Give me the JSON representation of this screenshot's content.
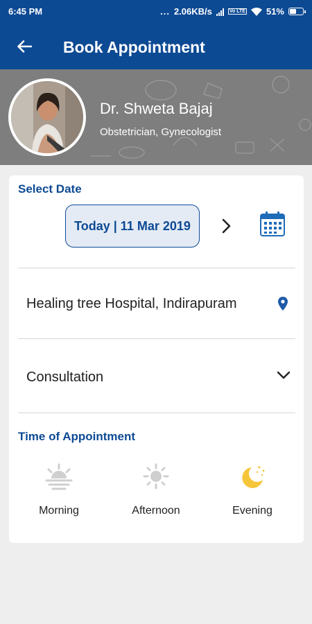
{
  "status_bar": {
    "time": "6:45 PM",
    "dots": "...",
    "network_speed": "2.06KB/s",
    "volte": "Vo LTE",
    "battery": "51%",
    "battery_level": 0.51
  },
  "header": {
    "title": "Book Appointment",
    "back_icon": "arrow-left-icon"
  },
  "doctor": {
    "name": "Dr. Shweta Bajaj",
    "specialization": "Obstetrician, Gynecologist"
  },
  "appointment": {
    "select_date_label": "Select Date",
    "date": "Today | 11 Mar 2019",
    "hospital": "Healing tree Hospital, Indirapuram",
    "type": "Consultation",
    "time_label": "Time of Appointment",
    "slots": [
      {
        "label": "Morning",
        "icon": "sunrise-icon"
      },
      {
        "label": "Afternoon",
        "icon": "sun-icon"
      },
      {
        "label": "Evening",
        "icon": "moon-icon"
      }
    ]
  },
  "colors": {
    "primary": "#0d4a94",
    "inactive_icon": "#cfcfcf",
    "evening_icon": "#f7c53a",
    "date_pill_bg": "#e4ebf5"
  }
}
